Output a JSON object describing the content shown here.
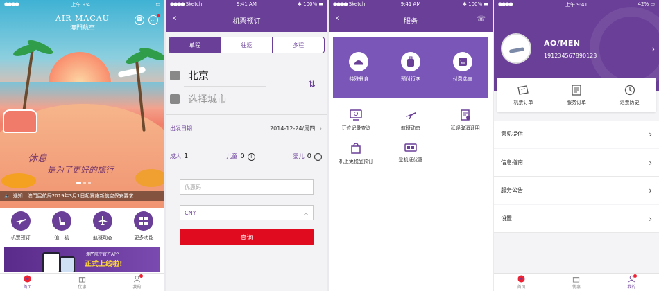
{
  "status": {
    "carrier": "Sketch",
    "time": "上午 9:41",
    "time_en": "9:41 AM",
    "battery": "100%",
    "battery_low": "42%"
  },
  "home": {
    "logo_en": "AIR MACAU",
    "logo_cn": "澳門航空",
    "slogan_line1": "休息",
    "slogan_line2": "是为了更好的旅行",
    "notice": "通知：澳門民航局2019年3月1日起實施新航空保安要求",
    "quick": [
      {
        "label": "机票预订",
        "icon": "plane-icon"
      },
      {
        "label": "值　机",
        "icon": "seat-icon"
      },
      {
        "label": "航班动态",
        "icon": "flight-icon"
      },
      {
        "label": "更多功能",
        "icon": "grid-icon"
      }
    ],
    "banner_small": "澳門航空官方APP",
    "banner_big": "正式上线啦!"
  },
  "tabs": [
    {
      "label": "首页"
    },
    {
      "label": "优惠"
    },
    {
      "label": "我的"
    }
  ],
  "booking": {
    "title": "机票预订",
    "segments": [
      "单程",
      "往返",
      "多程"
    ],
    "from_city": "北京",
    "to_city": "选择城市",
    "date_label": "出发日期",
    "date_value": "2014-12-24/周四",
    "adult_label": "成人",
    "adult_count": "1",
    "child_label": "儿童",
    "child_count": "0",
    "infant_label": "婴儿",
    "infant_count": "0",
    "promo_placeholder": "优惠码",
    "currency": "CNY",
    "search_label": "查询"
  },
  "service": {
    "title": "服务",
    "top": [
      {
        "label": "特殊餐食",
        "icon": "meal-icon"
      },
      {
        "label": "预付行李",
        "icon": "luggage-icon"
      },
      {
        "label": "付费选座",
        "icon": "seat-select-icon"
      }
    ],
    "items": [
      {
        "label": "订位记录查询",
        "icon": "record-icon"
      },
      {
        "label": "航班动态",
        "icon": "flight-status-icon"
      },
      {
        "label": "延误取消证明",
        "icon": "certificate-icon"
      },
      {
        "label": "机上免税品预订",
        "icon": "dutyfree-icon"
      },
      {
        "label": "登机证优惠",
        "icon": "boardingpass-icon"
      }
    ]
  },
  "profile": {
    "name": "AO/MEN",
    "id": "191234567890123",
    "cards": [
      {
        "label": "机票订单",
        "icon": "ticket-order-icon"
      },
      {
        "label": "服务订单",
        "icon": "service-order-icon"
      },
      {
        "label": "退票历史",
        "icon": "refund-history-icon"
      }
    ],
    "menu": [
      "意见提供",
      "信息指南",
      "服务公告",
      "设置"
    ]
  },
  "colors": {
    "brand": "#6a3f98",
    "accent_red": "#e10b1f"
  }
}
